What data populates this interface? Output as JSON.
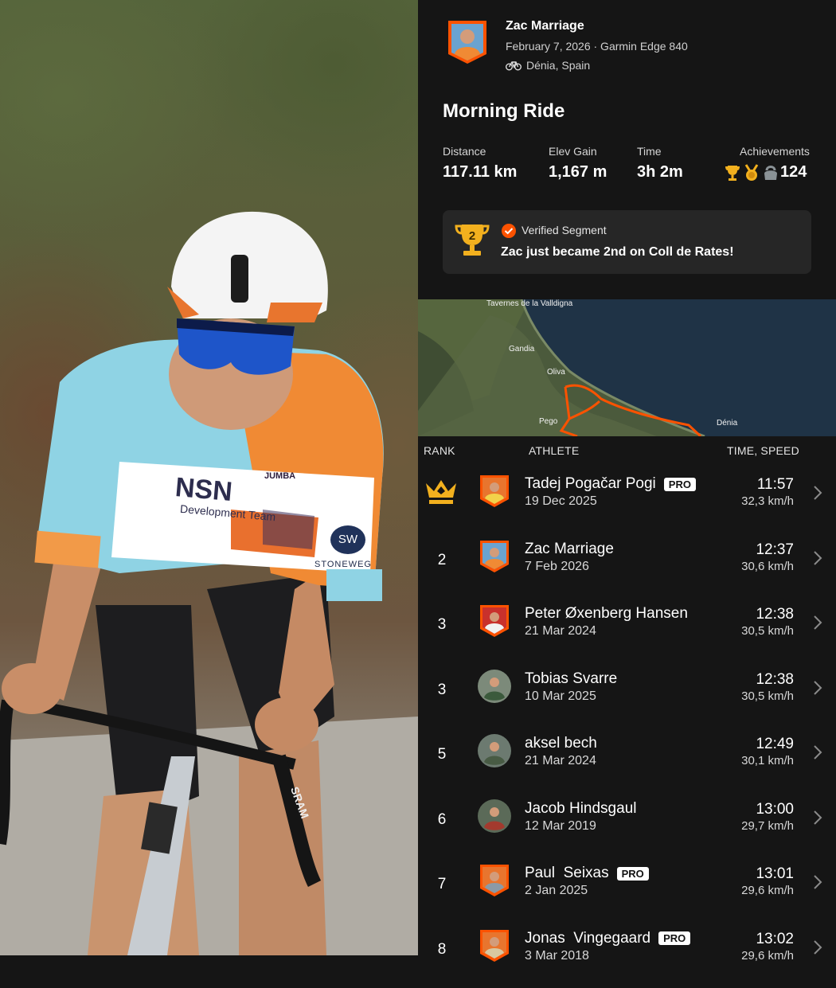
{
  "activity": {
    "athlete_name": "Zac Marriage",
    "meta": "February 7, 2026 · Garmin Edge 840",
    "location": "Dénia, Spain",
    "title": "Morning Ride"
  },
  "stats": [
    {
      "label": "Distance",
      "value": "117.11 km"
    },
    {
      "label": "Elev Gain",
      "value": "1,167 m"
    },
    {
      "label": "Time",
      "value": "3h 2m"
    }
  ],
  "achievements": {
    "label": "Achievements",
    "count": "124",
    "icons": [
      "trophy-gold-icon",
      "medal-gold-icon",
      "kettlebell-icon"
    ]
  },
  "verified": {
    "label": "Verified Segment",
    "message": "Zac just became 2nd on Coll de Rates!",
    "trophy_number": "2"
  },
  "map_labels": [
    "Tavernes de la Valldigna",
    "Gandia",
    "Oliva",
    "Pego",
    "Dénia"
  ],
  "leaderboard": {
    "headers": {
      "rank": "RANK",
      "athlete": "ATHLETE",
      "time": "TIME, SPEED"
    },
    "rows": [
      {
        "rank": "",
        "crown": true,
        "name": "Tadej Pogačar Pogi",
        "pro": "PRO",
        "date": "19 Dec 2025",
        "time": "11:57",
        "speed": "32,3 km/h"
      },
      {
        "rank": "2",
        "name": "Zac Marriage",
        "pro": "",
        "date": "7 Feb 2026",
        "time": "12:37",
        "speed": "30,6 km/h"
      },
      {
        "rank": "3",
        "name": "Peter Øxenberg Hansen",
        "pro": "",
        "date": "21 Mar 2024",
        "time": "12:38",
        "speed": "30,5 km/h"
      },
      {
        "rank": "3",
        "name": "Tobias Svarre",
        "pro": "",
        "date": "10 Mar 2025",
        "time": "12:38",
        "speed": "30,5 km/h"
      },
      {
        "rank": "5",
        "name": "aksel bech",
        "pro": "",
        "date": "21 Mar 2024",
        "time": "12:49",
        "speed": "30,1 km/h"
      },
      {
        "rank": "6",
        "name": "Jacob Hindsgaul",
        "pro": "",
        "date": "12 Mar 2019",
        "time": "13:00",
        "speed": "29,7 km/h"
      },
      {
        "rank": "7",
        "name": "Paul  Seixas",
        "pro": "PRO",
        "date": "2 Jan 2025",
        "time": "13:01",
        "speed": "29,6 km/h"
      },
      {
        "rank": "8",
        "name": "Jonas  Vingegaard",
        "pro": "PRO",
        "date": "3 Mar 2018",
        "time": "13:02",
        "speed": "29,6 km/h"
      }
    ]
  },
  "colors": {
    "accent": "#fc5200",
    "gold": "#f2b01e",
    "background": "#151515",
    "card": "#262626"
  },
  "photo": {
    "jersey_texts": [
      "NSN",
      "Development Team",
      "SW",
      "STONEWEG",
      "JUMBA",
      "SRAM"
    ]
  }
}
